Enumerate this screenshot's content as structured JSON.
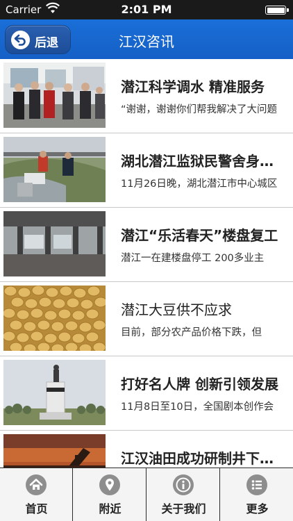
{
  "status_bar": {
    "carrier": "Carrier",
    "time": "2:01 PM"
  },
  "nav": {
    "back_label": "后退",
    "title": "江汉咨讯"
  },
  "articles": [
    {
      "title": "潜江科学调水 精准服务",
      "summary": "“谢谢，谢谢你们帮我解决了大问题",
      "thumb_icon": "officials-visit-photo"
    },
    {
      "title": "湖北潜江监狱民警舍身救人",
      "summary": "11月26日晚，湖北潜江市中心城区",
      "thumb_icon": "rescue-scene-photo"
    },
    {
      "title": "潜江“乐活春天”楼盘复工",
      "summary": "潜江一在建楼盘停工 200多业主",
      "thumb_icon": "construction-site-photo"
    },
    {
      "title": "潜江大豆供不应求",
      "summary": "目前，部分农产品价格下跌，但",
      "thumb_icon": "soybeans-photo"
    },
    {
      "title": "打好名人牌 创新引领发展",
      "summary": "11月8日至10日，全国剧本创作会",
      "thumb_icon": "statue-monument-photo"
    },
    {
      "title": "江汉油田成功研制井下工具",
      "summary": "",
      "thumb_icon": "oil-pump-sunset-photo"
    }
  ],
  "tabs": [
    {
      "label": "首页",
      "icon": "home-icon"
    },
    {
      "label": "附近",
      "icon": "location-pin-icon"
    },
    {
      "label": "关于我们",
      "icon": "info-icon"
    },
    {
      "label": "更多",
      "icon": "list-icon"
    }
  ],
  "colors": {
    "nav_blue": "#1a6fd8",
    "tab_icon_gray": "#8e8e8e"
  }
}
